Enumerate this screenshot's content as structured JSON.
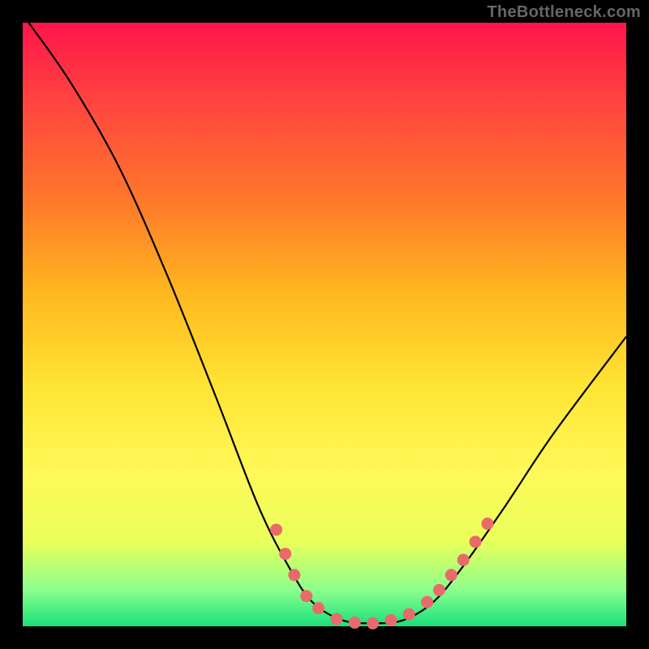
{
  "watermark": "TheBottleneck.com",
  "chart_data": {
    "type": "line",
    "title": "",
    "xlabel": "",
    "ylabel": "",
    "xlim": [
      0,
      100
    ],
    "ylim": [
      0,
      100
    ],
    "curve_points": [
      {
        "x": 1,
        "y": 100
      },
      {
        "x": 8,
        "y": 90
      },
      {
        "x": 16,
        "y": 76
      },
      {
        "x": 24,
        "y": 58
      },
      {
        "x": 32,
        "y": 38
      },
      {
        "x": 39,
        "y": 20
      },
      {
        "x": 44,
        "y": 10
      },
      {
        "x": 48,
        "y": 4
      },
      {
        "x": 53,
        "y": 1
      },
      {
        "x": 58,
        "y": 0.5
      },
      {
        "x": 63,
        "y": 1
      },
      {
        "x": 68,
        "y": 4
      },
      {
        "x": 73,
        "y": 10
      },
      {
        "x": 80,
        "y": 20
      },
      {
        "x": 88,
        "y": 32
      },
      {
        "x": 100,
        "y": 48
      }
    ],
    "marker_points": [
      {
        "x": 42,
        "y": 16
      },
      {
        "x": 43.5,
        "y": 12
      },
      {
        "x": 45,
        "y": 8.5
      },
      {
        "x": 47,
        "y": 5
      },
      {
        "x": 49,
        "y": 3
      },
      {
        "x": 52,
        "y": 1.2
      },
      {
        "x": 55,
        "y": 0.6
      },
      {
        "x": 58,
        "y": 0.5
      },
      {
        "x": 61,
        "y": 1
      },
      {
        "x": 64,
        "y": 2
      },
      {
        "x": 67,
        "y": 4
      },
      {
        "x": 69,
        "y": 6
      },
      {
        "x": 71,
        "y": 8.5
      },
      {
        "x": 73,
        "y": 11
      },
      {
        "x": 75,
        "y": 14
      },
      {
        "x": 77,
        "y": 17
      }
    ],
    "notes": "V-shaped bottleneck curve over red→green vertical gradient; no axis ticks or labels visible."
  }
}
